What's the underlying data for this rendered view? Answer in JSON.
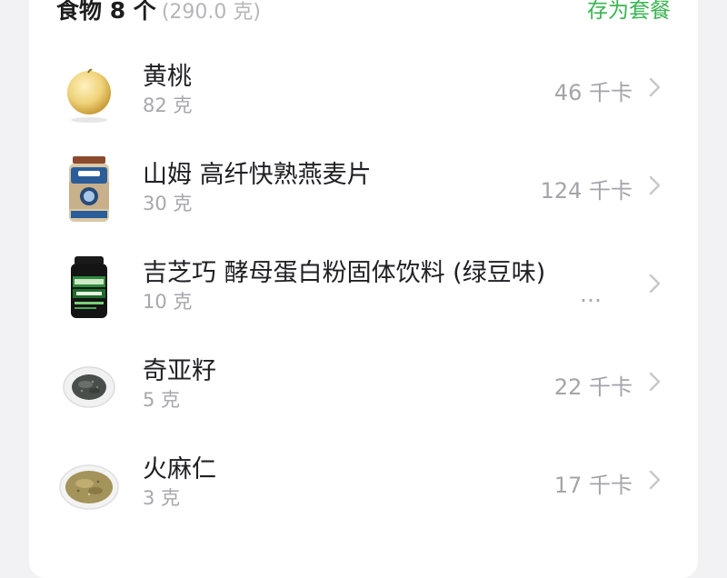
{
  "header": {
    "title": "食物 8 个",
    "subtitle": "(290.0 克)",
    "save_as_meal": "存为套餐"
  },
  "foods": [
    {
      "name": "黄桃",
      "weight": "82 克",
      "calories": "46 千卡",
      "icon": "yellow-peach-icon"
    },
    {
      "name": "山姆 高纤快熟燕麦片",
      "weight": "30 克",
      "calories": "124 千卡",
      "icon": "oatmeal-jar-icon"
    },
    {
      "name": "吉芝巧 酵母蛋白粉固体饮料 (绿豆味)",
      "weight": "10 克",
      "calories": "…",
      "icon": "protein-powder-tub-icon"
    },
    {
      "name": "奇亚籽",
      "weight": "5 克",
      "calories": "22 千卡",
      "icon": "chia-seeds-bowl-icon"
    },
    {
      "name": "火麻仁",
      "weight": "3 克",
      "calories": "17 千卡",
      "icon": "hemp-seeds-plate-icon"
    }
  ],
  "colors": {
    "accent_green": "#3ab552",
    "text_primary": "#202024",
    "text_secondary": "#a7a7ad",
    "background": "#f2f2f4"
  }
}
